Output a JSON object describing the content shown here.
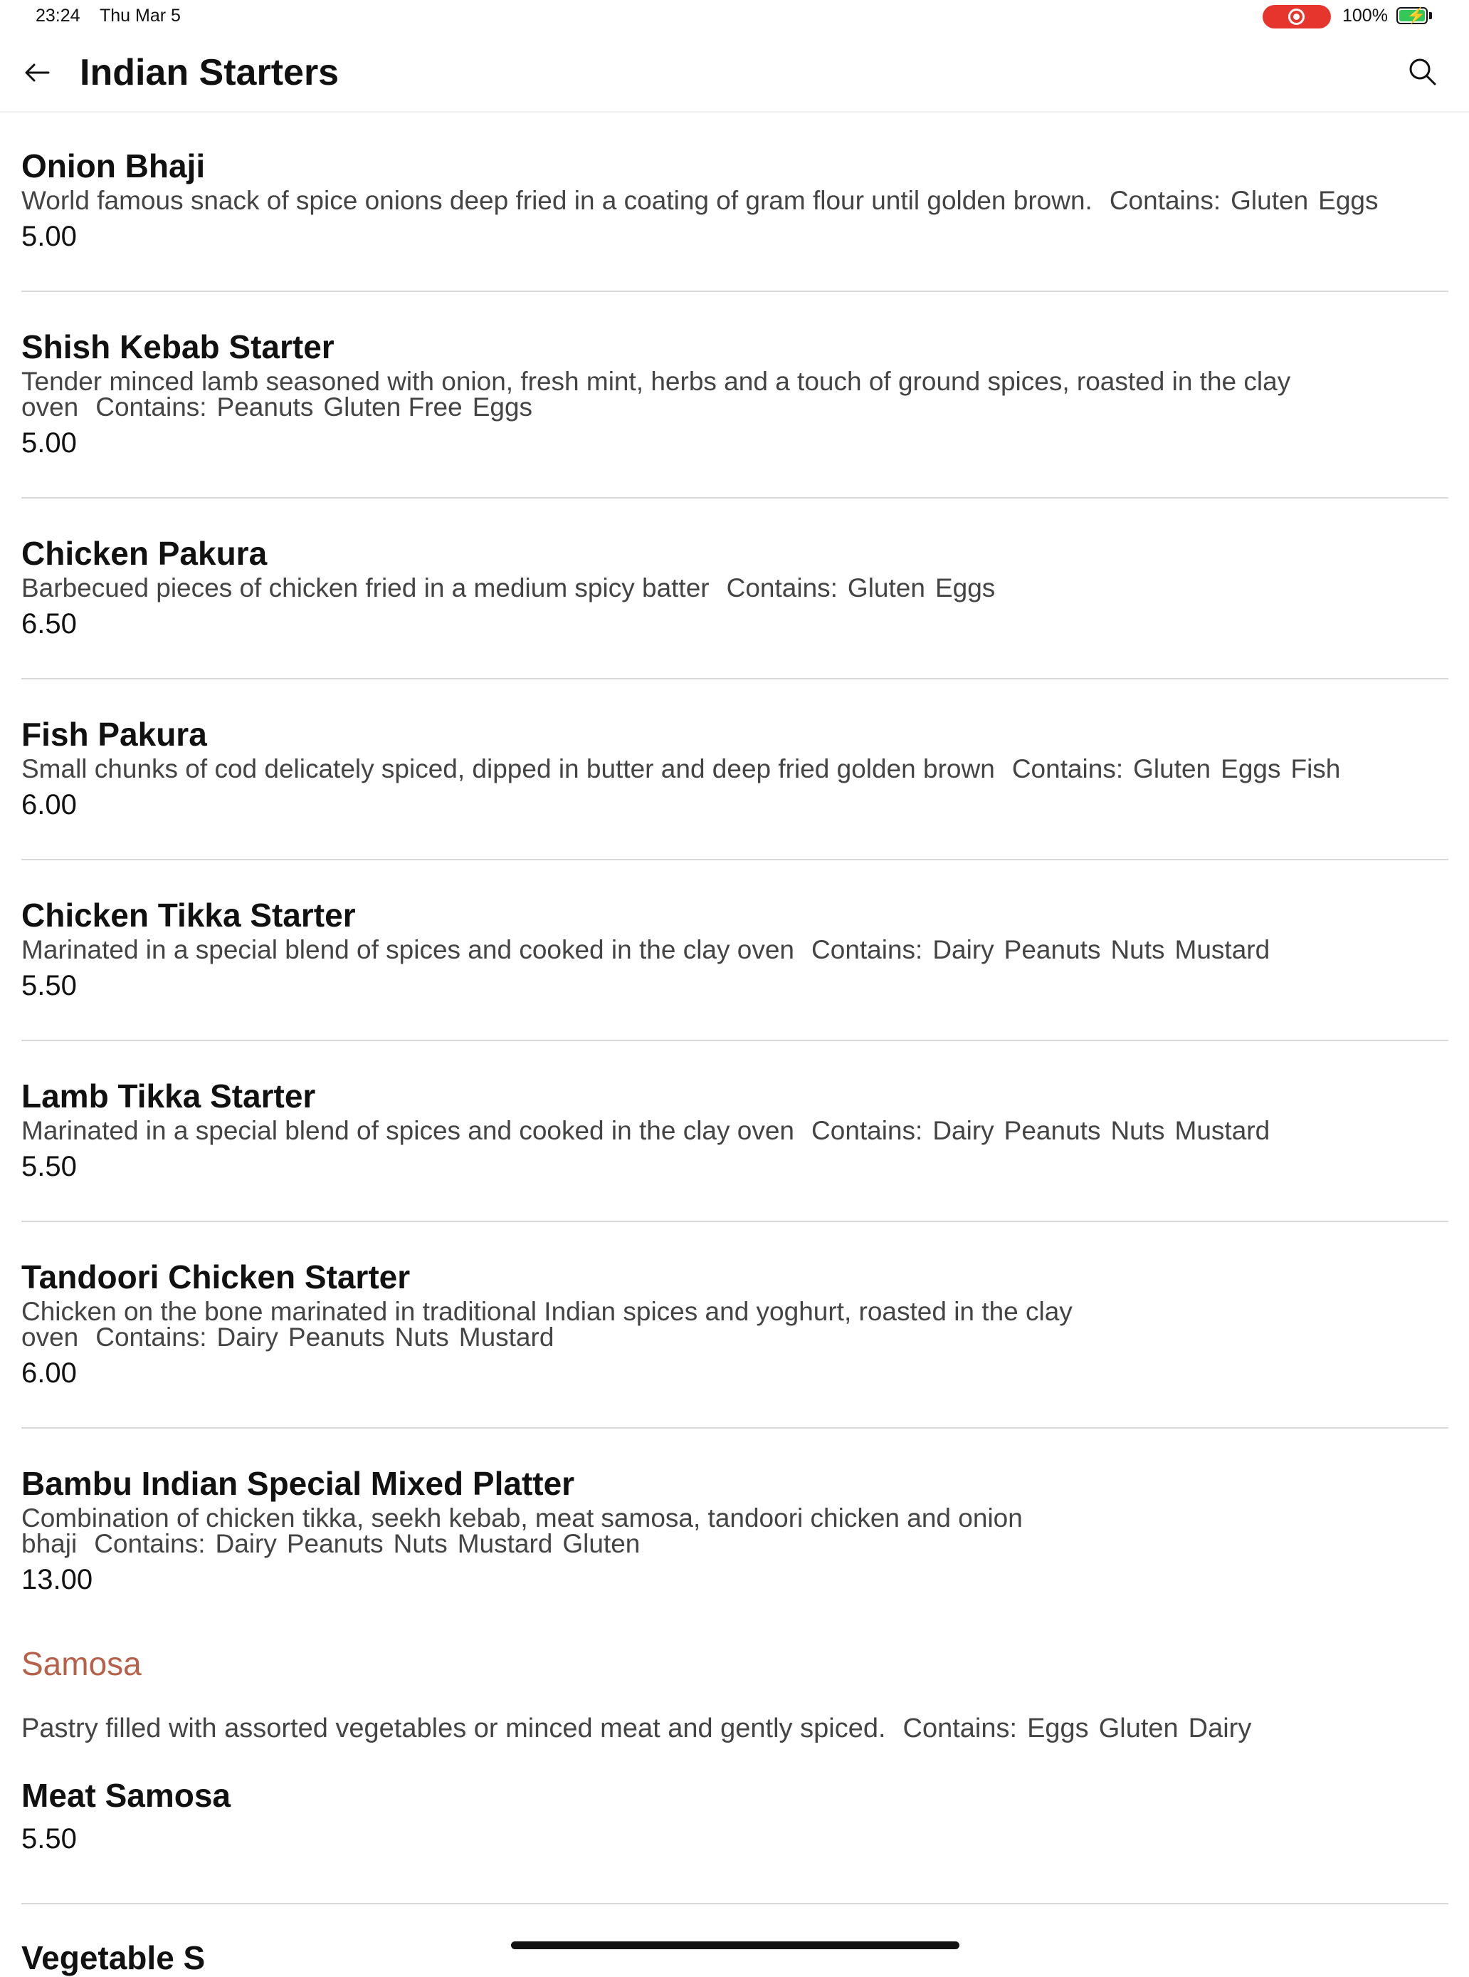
{
  "status_bar": {
    "time": "23:24",
    "date": "Thu Mar 5",
    "battery": "100%",
    "colors": {
      "recording": "#e5352c",
      "battery_fill": "#35c759"
    }
  },
  "header": {
    "title": "Indian Starters",
    "back_icon": "arrow-left-icon",
    "search_icon": "search-icon"
  },
  "contains_label": "Contains:",
  "items": [
    {
      "name": "Onion Bhaji",
      "description": "World famous snack of spice onions deep fried in a coating of gram flour until golden brown.",
      "allergens": [
        "Gluten",
        "Eggs"
      ],
      "price": "5.00"
    },
    {
      "name": "Shish Kebab Starter",
      "description": "Tender minced lamb seasoned with onion, fresh mint, herbs and a touch of ground spices, roasted in the clay oven",
      "allergens": [
        "Peanuts",
        "Gluten Free",
        "Eggs"
      ],
      "price": "5.00"
    },
    {
      "name": "Chicken Pakura",
      "description": "Barbecued pieces of chicken fried in a medium spicy batter",
      "allergens": [
        "Gluten",
        "Eggs"
      ],
      "price": "6.50"
    },
    {
      "name": "Fish Pakura",
      "description": "Small chunks of cod delicately spiced, dipped in butter and deep fried golden brown",
      "allergens": [
        "Gluten",
        "Eggs",
        "Fish"
      ],
      "price": "6.00"
    },
    {
      "name": "Chicken Tikka Starter",
      "description": "Marinated in a special blend of spices and cooked in the clay oven",
      "allergens": [
        "Dairy",
        "Peanuts",
        "Nuts",
        "Mustard"
      ],
      "price": "5.50"
    },
    {
      "name": "Lamb Tikka Starter",
      "description": "Marinated in a special blend of spices and cooked in the clay oven",
      "allergens": [
        "Dairy",
        "Peanuts",
        "Nuts",
        "Mustard"
      ],
      "price": "5.50"
    },
    {
      "name": "Tandoori Chicken Starter",
      "description": "Chicken on the bone marinated in traditional Indian spices and yoghurt, roasted in the clay oven",
      "allergens": [
        "Dairy",
        "Peanuts",
        "Nuts",
        "Mustard"
      ],
      "price": "6.00"
    },
    {
      "name": "Bambu Indian Special Mixed Platter",
      "description": "Combination of chicken tikka, seekh kebab, meat samosa, tandoori chicken and onion bhaji",
      "allergens": [
        "Dairy",
        "Peanuts",
        "Nuts",
        "Mustard",
        "Gluten"
      ],
      "price": "13.00"
    }
  ],
  "samosa_section": {
    "title": "Samosa",
    "description": "Pastry filled with assorted vegetables or minced meat and gently spiced.",
    "allergens": [
      "Eggs",
      "Gluten",
      "Dairy"
    ],
    "color": "#b8614a",
    "items": [
      {
        "name": "Meat Samosa",
        "price": "5.50"
      }
    ],
    "next_partial": "Vegetable S"
  }
}
